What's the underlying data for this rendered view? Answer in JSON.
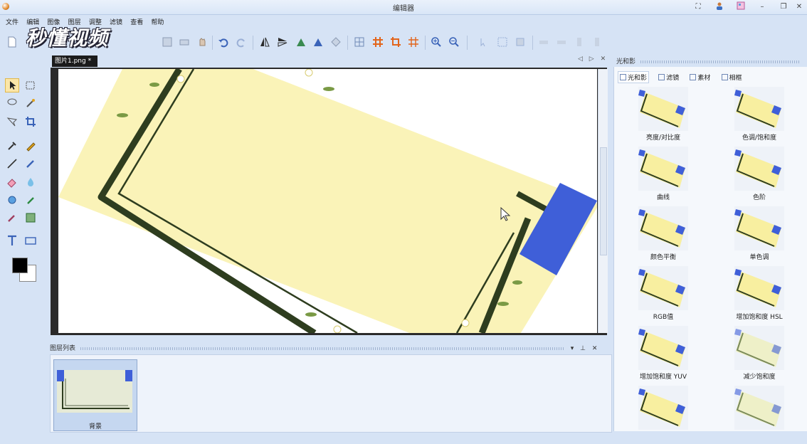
{
  "window": {
    "title": "编辑器"
  },
  "menu": [
    "文件",
    "编辑",
    "图像",
    "图层",
    "调整",
    "滤镜",
    "查看",
    "帮助"
  ],
  "watermark": "秒懂视频",
  "document": {
    "tab_label": "图片1.png *"
  },
  "layers_panel": {
    "title": "图层列表",
    "layers": [
      {
        "name": "背景"
      }
    ]
  },
  "effects_panel": {
    "title": "光和影",
    "tabs": [
      "光和影",
      "滤镜",
      "素材",
      "相框"
    ],
    "items": [
      "亮度/对比度",
      "色调/饱和度",
      "曲线",
      "色阶",
      "颜色平衡",
      "单色调",
      "RGB值",
      "增加饱和度 HSL",
      "增加饱和度 YUV",
      "减少饱和度",
      "",
      ""
    ]
  },
  "colors": {
    "accent": "#3f5fd8",
    "canvas_yellow": "#faf3b8",
    "frame_green": "#2e3d1f",
    "panel_bg": "#d6e3f5"
  }
}
